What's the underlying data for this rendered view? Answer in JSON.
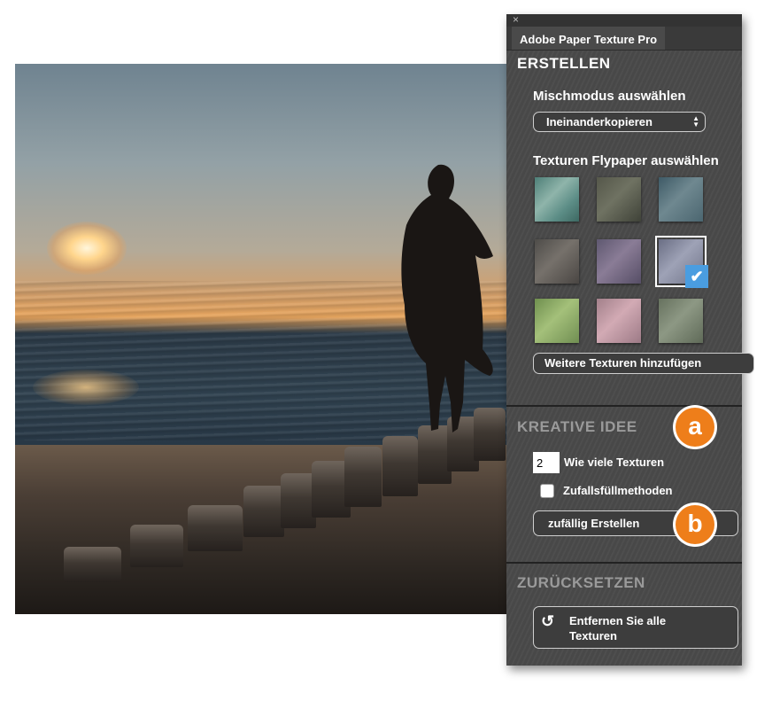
{
  "panel": {
    "close_glyph": "×",
    "tab_title": "Adobe Paper Texture Pro",
    "create": {
      "title": "ERSTELLEN",
      "blend_label": "Mischmodus auswählen",
      "blend_value": "Ineinanderkopieren",
      "textures_label": "Texturen Flypaper auswählen",
      "more_textures_button": "Weitere Texturen hinzufügen",
      "selected_check": "✔"
    },
    "idea": {
      "title": "KREATIVE IDEE",
      "count_value": "2",
      "count_label": "Wie viele Texturen",
      "random_fill_label": "Zufallsfüllmethoden",
      "random_create_button": "zufällig Erstellen"
    },
    "reset": {
      "title": "ZURÜCKSETZEN",
      "remove_button_line1": "Entfernen Sie alle",
      "remove_button_line2": "Texturen",
      "reset_glyph": "↺"
    }
  },
  "callouts": {
    "a": "a",
    "b": "b"
  },
  "colors": {
    "panel_bg": "#4a4a4a",
    "accent_orange": "#ee7e1a",
    "check_blue": "#4a9de0"
  }
}
